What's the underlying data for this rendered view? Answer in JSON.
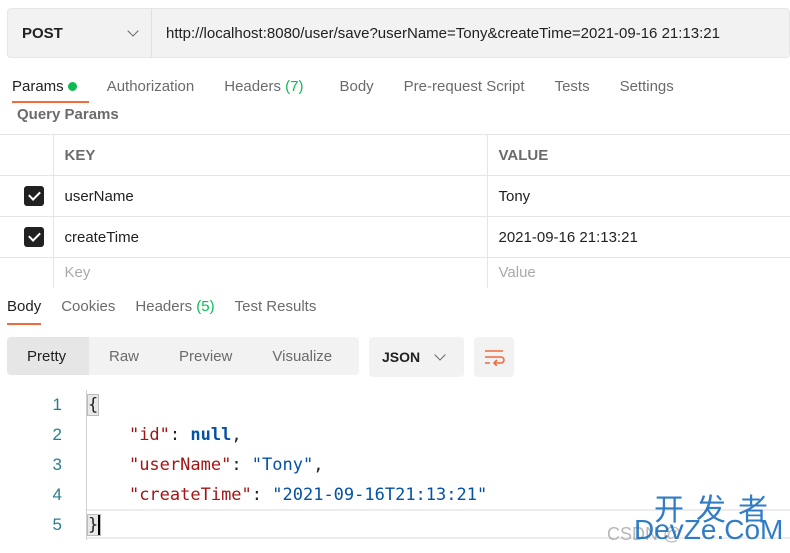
{
  "request": {
    "method": "POST",
    "url": "http://localhost:8080/user/save?userName=Tony&createTime=2021-09-16 21:13:21"
  },
  "req_tabs": [
    {
      "label": "Params"
    },
    {
      "label": "Authorization"
    },
    {
      "label": "Headers",
      "count": "(7)"
    },
    {
      "label": "Body"
    },
    {
      "label": "Pre-request Script"
    },
    {
      "label": "Tests"
    },
    {
      "label": "Settings"
    }
  ],
  "query_params": {
    "title": "Query Params",
    "headers": {
      "key": "KEY",
      "value": "VALUE"
    },
    "rows": [
      {
        "key": "userName",
        "value": "Tony",
        "checked": true
      },
      {
        "key": "createTime",
        "value": "2021-09-16 21:13:21",
        "checked": true
      }
    ],
    "placeholder": {
      "key": "Key",
      "value": "Value"
    }
  },
  "resp_tabs": [
    {
      "label": "Body"
    },
    {
      "label": "Cookies"
    },
    {
      "label": "Headers",
      "count": "(5)"
    },
    {
      "label": "Test Results"
    }
  ],
  "view_modes": [
    "Pretty",
    "Raw",
    "Preview",
    "Visualize"
  ],
  "format": "JSON",
  "code": {
    "l1": "{",
    "l2k": "\"id\"",
    "l2v": "null",
    "l3k": "\"userName\"",
    "l3v": "\"Tony\"",
    "l4k": "\"createTime\"",
    "l4v": "\"2021-09-16T21:13:21\"",
    "l5": "}"
  },
  "watermark": {
    "top": "开发者",
    "bottom": "DevZe.CoM",
    "under": "CSDN @"
  },
  "colors": {
    "accent": "#f26b3a",
    "green": "#0cbb52"
  }
}
